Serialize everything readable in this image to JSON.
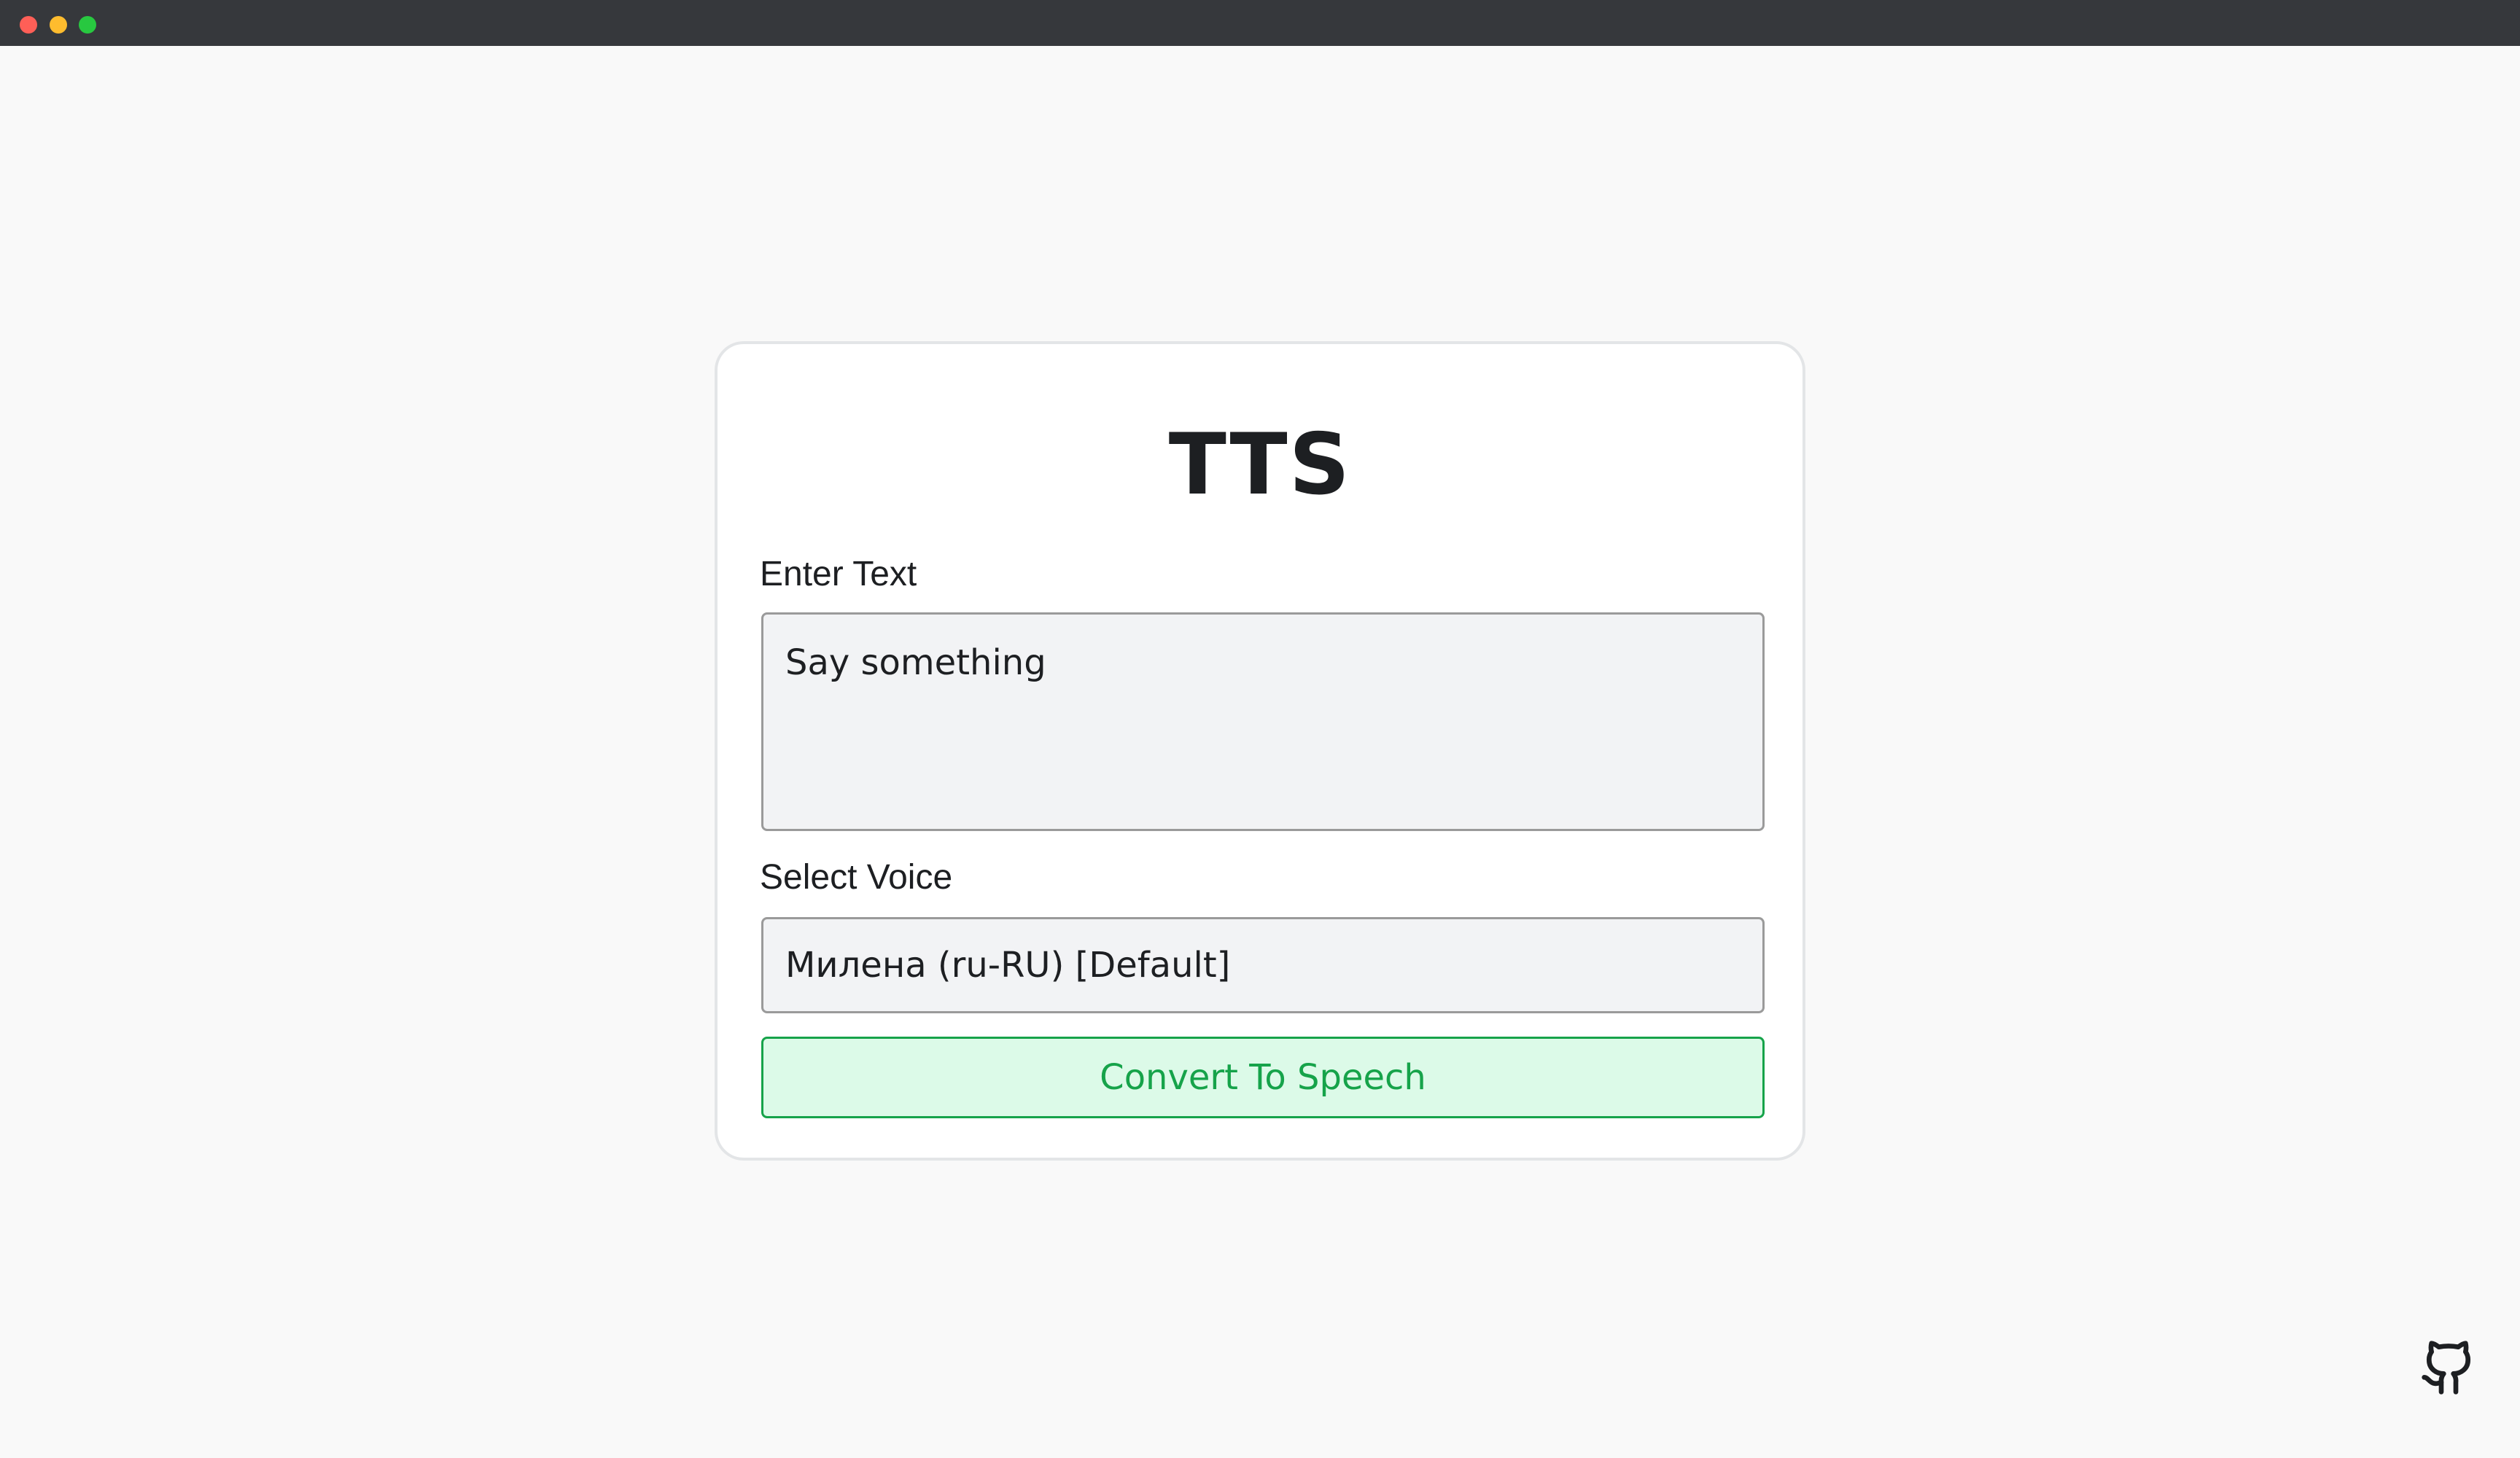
{
  "window": {
    "controls": [
      "close",
      "minimize",
      "maximize"
    ]
  },
  "app": {
    "title": "TTS"
  },
  "form": {
    "text_label": "Enter Text",
    "text_value": "Say something",
    "voice_label": "Select Voice",
    "voice_selected": "Милена (ru-RU) [Default]",
    "convert_label": "Convert To Speech"
  },
  "footer": {
    "icon": "github-icon"
  },
  "colors": {
    "background": "#f9f9f9",
    "titlebar": "#36383c",
    "button_text": "#16a34a",
    "button_bg": "#dcfae8",
    "input_bg": "#f2f3f5"
  }
}
